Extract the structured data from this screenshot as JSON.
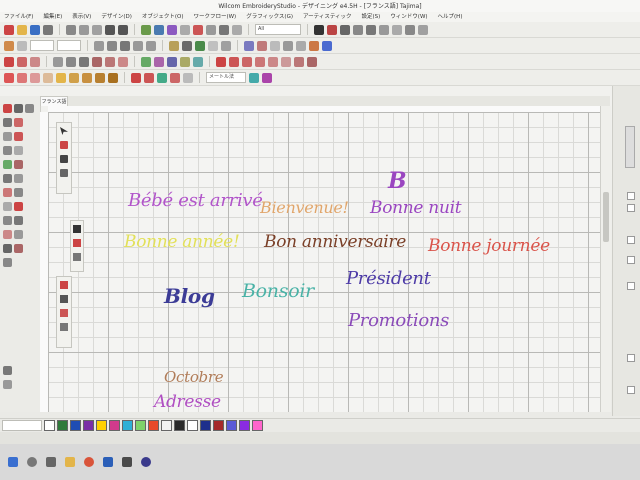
{
  "window": {
    "title": "Wilcom EmbroideryStudio - デザイニング e4.5H - [フランス語] Tajima]",
    "menu": [
      "ファイル(F)",
      "編集(E)",
      "表示(V)",
      "デザイン(D)",
      "オブジェクト(O)",
      "ワークフロー(W)",
      "グラフィックス(G)",
      "アーティスティック",
      "設定(S)",
      "ウィンドウ(W)",
      "ヘルプ(H)"
    ]
  },
  "toolbar": {
    "fabric_field": "All",
    "units_field": "メートル法"
  },
  "document": {
    "tab_label": "フランス語"
  },
  "designs": [
    {
      "text": "Bébé est arrivé",
      "color": "#b155c9"
    },
    {
      "text": "Bienvenue!",
      "color": "#e0a56a"
    },
    {
      "text": "B",
      "color": "#9a46c0"
    },
    {
      "text": "Bonne nuit",
      "color": "#9a46c0"
    },
    {
      "text": "Bonne année!",
      "color": "#e2e05a"
    },
    {
      "text": "Bon anniversaire",
      "color": "#7a4028"
    },
    {
      "text": "Bonne journée",
      "color": "#d9544a"
    },
    {
      "text": "Blog",
      "color": "#3c3c96"
    },
    {
      "text": "Bonsoir",
      "color": "#4ab2a6"
    },
    {
      "text": "Président",
      "color": "#4d3ba6"
    },
    {
      "text": "Promotions",
      "color": "#8a4bb8"
    },
    {
      "text": "Octobre",
      "color": "#b07c58"
    },
    {
      "text": "Adresse",
      "color": "#b04fc2"
    }
  ],
  "palette_colors": [
    "#ffffff",
    "#2f7a3a",
    "#1f4db3",
    "#7a2fa6",
    "#ffd200",
    "#d23a8c",
    "#2fb0d6",
    "#7fd36b",
    "#e84a2a",
    "#f2f2f2",
    "#2a2a2a",
    "#ffffff",
    "#1e2f8c",
    "#a52a2a",
    "#5b5bd6",
    "#8a2be2",
    "#ff66cc"
  ],
  "icons": {
    "toolbar": [
      "file-new-icon",
      "open-icon",
      "save-icon",
      "print-icon",
      "cut-icon",
      "copy-icon",
      "paste-icon",
      "undo-icon",
      "redo-icon",
      "zoom-icon",
      "help-icon",
      "info-icon",
      "grid-icon",
      "stitch-icon"
    ],
    "taskbar": [
      "windows-start-icon",
      "search-icon",
      "task-view-icon",
      "file-explorer-icon",
      "chrome-icon",
      "word-icon",
      "mail-icon",
      "embroiderystudio-icon"
    ]
  }
}
